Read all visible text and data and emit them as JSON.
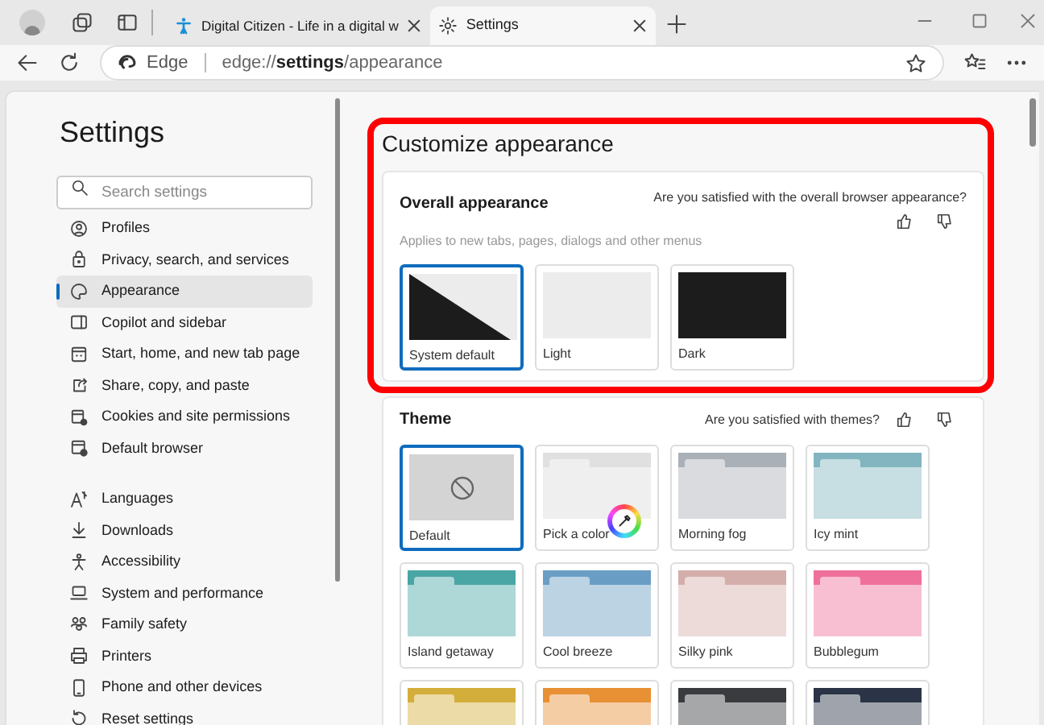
{
  "tabs": [
    {
      "title": "Digital Citizen - Life in a digital w",
      "kind": "page",
      "selected": false
    },
    {
      "title": "Settings",
      "kind": "settings",
      "selected": true
    }
  ],
  "address_bar": {
    "label": "Edge",
    "url_prefix": "edge://",
    "url_bold": "settings",
    "url_suffix": "/appearance"
  },
  "sidebar": {
    "title": "Settings",
    "search": {
      "placeholder": "Search settings"
    },
    "groups": [
      [
        {
          "label": "Profiles",
          "kind": "person",
          "selected": false
        },
        {
          "label": "Privacy, search, and services",
          "kind": "lock",
          "selected": false
        },
        {
          "label": "Appearance",
          "kind": "palette",
          "selected": true
        },
        {
          "label": "Copilot and sidebar",
          "kind": "sidebar",
          "selected": false
        },
        {
          "label": "Start, home, and new tab page",
          "kind": "home",
          "selected": false
        },
        {
          "label": "Share, copy, and paste",
          "kind": "share",
          "selected": false
        },
        {
          "label": "Cookies and site permissions",
          "kind": "cookie",
          "selected": false
        },
        {
          "label": "Default browser",
          "kind": "browser",
          "selected": false
        }
      ],
      [
        {
          "label": "Languages",
          "kind": "lang",
          "selected": false
        },
        {
          "label": "Downloads",
          "kind": "download",
          "selected": false
        },
        {
          "label": "Accessibility",
          "kind": "access",
          "selected": false
        },
        {
          "label": "System and performance",
          "kind": "laptop",
          "selected": false
        },
        {
          "label": "Family safety",
          "kind": "family",
          "selected": false
        },
        {
          "label": "Printers",
          "kind": "printer",
          "selected": false
        },
        {
          "label": "Phone and other devices",
          "kind": "phone",
          "selected": false
        },
        {
          "label": "Reset settings",
          "kind": "reset",
          "selected": false
        }
      ]
    ]
  },
  "page_title": "Customize appearance",
  "overall_appearance": {
    "title": "Overall appearance",
    "highlighted": true,
    "feedback": "Are you satisfied with the overall browser appearance?",
    "description": "Applies to new tabs, pages, dialogs and other menus",
    "options": [
      {
        "label": "System default",
        "kind": "system",
        "selected": true
      },
      {
        "label": "Light",
        "kind": "light",
        "selected": false
      },
      {
        "label": "Dark",
        "kind": "dark",
        "selected": false
      }
    ]
  },
  "theme": {
    "title": "Theme",
    "feedback": "Are you satisfied with themes?",
    "items": [
      {
        "label": "Default",
        "kind": "none",
        "selected": true
      },
      {
        "label": "Pick a color",
        "kind": "picker",
        "selected": false
      },
      {
        "label": "Morning fog",
        "kind": "swatch",
        "color": "#aab0b8",
        "selected": false
      },
      {
        "label": "Icy mint",
        "kind": "swatch",
        "color": "#82b5bf",
        "selected": false
      },
      {
        "label": "Island getaway",
        "kind": "swatch",
        "color": "#4aa5a5",
        "selected": false
      },
      {
        "label": "Cool breeze",
        "kind": "swatch",
        "color": "#6a9ec4",
        "selected": false
      },
      {
        "label": "Silky pink",
        "kind": "swatch",
        "color": "#d4aeaa",
        "selected": false
      },
      {
        "label": "Bubblegum",
        "kind": "swatch",
        "color": "#f0709c",
        "selected": false
      },
      {
        "kind": "swatch",
        "color": "#d4ae3a",
        "selected": false
      },
      {
        "kind": "swatch",
        "color": "#e89034",
        "selected": false
      },
      {
        "kind": "swatch",
        "color": "#3a3b3e",
        "selected": false
      },
      {
        "kind": "swatch",
        "color": "#2a3446",
        "selected": false
      }
    ]
  }
}
